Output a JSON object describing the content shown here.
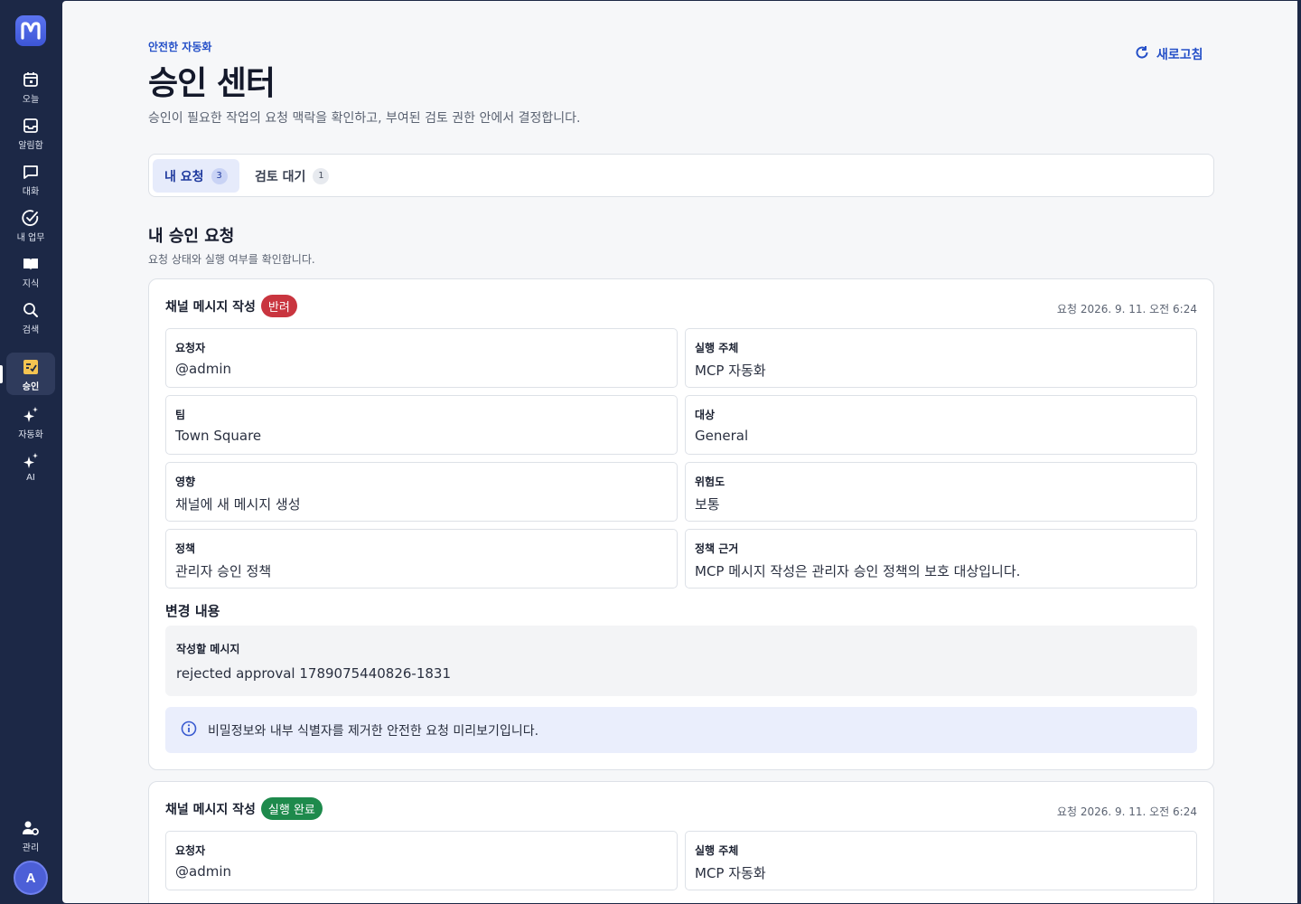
{
  "sidebar": {
    "items": [
      {
        "label": "오늘",
        "icon": "calendar-icon"
      },
      {
        "label": "알림함",
        "icon": "inbox-icon"
      },
      {
        "label": "대화",
        "icon": "chat-bubble-icon"
      },
      {
        "label": "내 업무",
        "icon": "task-check-icon"
      },
      {
        "label": "지식",
        "icon": "book-icon"
      },
      {
        "label": "검색",
        "icon": "search-icon"
      },
      {
        "label": "승인",
        "icon": "approval-icon"
      },
      {
        "label": "자동화",
        "icon": "sparkles-icon"
      },
      {
        "label": "AI",
        "icon": "ai-sparkles-icon"
      }
    ],
    "admin_label": "관리",
    "avatar_initial": "A",
    "active": "승인"
  },
  "header": {
    "eyebrow": "안전한 자동화",
    "title": "승인 센터",
    "description": "승인이 필요한 작업의 요청 맥락을 확인하고, 부여된 검토 권한 안에서 결정합니다.",
    "refresh_label": "새로고침"
  },
  "tabs": [
    {
      "label": "내 요청",
      "count": "3"
    },
    {
      "label": "검토 대기",
      "count": "1"
    }
  ],
  "section": {
    "title": "내 승인 요청",
    "description": "요청 상태와 실행 여부를 확인합니다."
  },
  "requests": [
    {
      "title": "채널 메시지 작성",
      "status": "반려",
      "time": "요청 2026. 9. 11. 오전 6:24",
      "fields": [
        {
          "label": "요청자",
          "value": "@admin"
        },
        {
          "label": "실행 주체",
          "value": "MCP 자동화"
        },
        {
          "label": "팀",
          "value": "Town Square"
        },
        {
          "label": "대상",
          "value": "General"
        },
        {
          "label": "영향",
          "value": "채널에 새 메시지 생성"
        },
        {
          "label": "위험도",
          "value": "보통"
        },
        {
          "label": "정책",
          "value": "관리자 승인 정책"
        },
        {
          "label": "정책 근거",
          "value": "MCP 메시지 작성은 관리자 승인 정책의 보호 대상입니다."
        }
      ],
      "change_title": "변경 내용",
      "change_label": "작성할 메시지",
      "change_value": "rejected approval 1789075440826-1831",
      "info": "비밀정보와 내부 식별자를 제거한 안전한 요청 미리보기입니다."
    },
    {
      "title": "채널 메시지 작성",
      "status": "실행 완료",
      "time": "요청 2026. 9. 11. 오전 6:24",
      "fields": [
        {
          "label": "요청자",
          "value": "@admin"
        },
        {
          "label": "실행 주체",
          "value": "MCP 자동화"
        }
      ]
    }
  ],
  "colors": {
    "sidebar_bg": "#1c2846",
    "accent": "#2550c8",
    "rejected": "#c9353f",
    "done": "#1e8a4c"
  }
}
